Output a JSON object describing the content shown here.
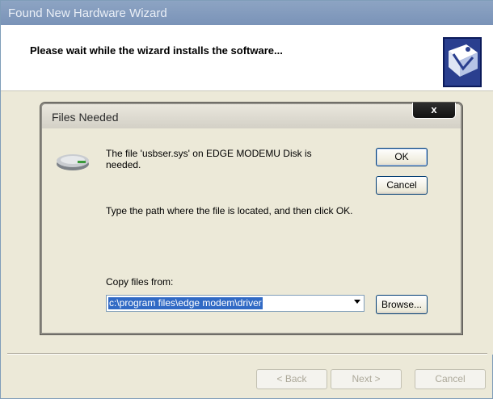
{
  "wizard": {
    "title": "Found New Hardware Wizard",
    "heading": "Please wait while the wizard installs the software...",
    "back_label": "< Back",
    "next_label": "Next >",
    "cancel_label": "Cancel"
  },
  "dialog": {
    "title": "Files Needed",
    "close_glyph": "x",
    "message": "The file 'usbser.sys' on EDGE MODEMU Disk is needed.",
    "instruction": "Type the path where the file is located, and then click OK.",
    "copy_label": "Copy files from:",
    "path_value": "c:\\program files\\edge modem\\driver",
    "ok_label": "OK",
    "cancel_label": "Cancel",
    "browse_label": "Browse..."
  },
  "colors": {
    "selection": "#316ac5",
    "titlebar": "#7a93b8",
    "face": "#ece9d8"
  },
  "icons": [
    "hardware-wizard-icon",
    "disk-drive-icon",
    "close-icon",
    "dropdown-arrow-icon"
  ]
}
